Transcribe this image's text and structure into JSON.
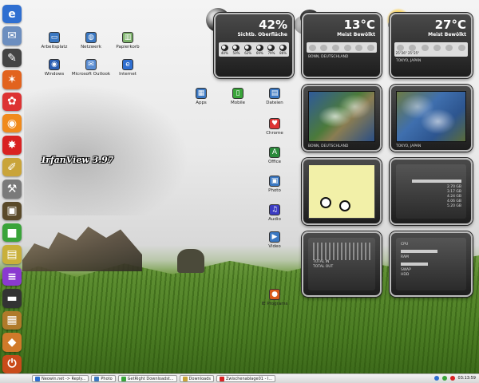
{
  "dock": {
    "items": [
      {
        "name": "internet-explorer-icon",
        "glyph": "e",
        "color": "#2f6fd1"
      },
      {
        "name": "mail-icon",
        "glyph": "✉",
        "color": "#6c8ebf"
      },
      {
        "name": "paintbrush-icon",
        "glyph": "✎",
        "color": "#444"
      },
      {
        "name": "firefox-icon",
        "glyph": "✶",
        "color": "#e2631e"
      },
      {
        "name": "flower-icon",
        "glyph": "✿",
        "color": "#d33"
      },
      {
        "name": "blender-icon",
        "glyph": "◉",
        "color": "#f08a1c"
      },
      {
        "name": "irfanview-icon",
        "glyph": "✸",
        "color": "#d92222"
      },
      {
        "name": "brushes-icon",
        "glyph": "✐",
        "color": "#c9a43a"
      },
      {
        "name": "tools-icon",
        "glyph": "⚒",
        "color": "#7a7a7a"
      },
      {
        "name": "folder-icon",
        "glyph": "▣",
        "color": "#5a4a2a"
      },
      {
        "name": "green-app-icon",
        "glyph": "■",
        "color": "#3aa43a"
      },
      {
        "name": "books-icon",
        "glyph": "▤",
        "color": "#c9b03a"
      },
      {
        "name": "stack-icon",
        "glyph": "≡",
        "color": "#8a3ad0"
      },
      {
        "name": "key-icon",
        "glyph": "▬",
        "color": "#333"
      },
      {
        "name": "package-icon",
        "glyph": "▦",
        "color": "#b07a2a"
      },
      {
        "name": "car-icon",
        "glyph": "◆",
        "color": "#d07a2a"
      },
      {
        "name": "power-icon",
        "glyph": "⏻",
        "color": "#c94b1a"
      }
    ],
    "hover_label": "IrfanView 3.97"
  },
  "desktop_icons": [
    {
      "name": "arbeitsplatz-icon",
      "label": "Arbeitsplatz",
      "color": "#3b78c2",
      "glyph": "▭"
    },
    {
      "name": "netzwerk-icon",
      "label": "Netzwerk",
      "color": "#3b78c2",
      "glyph": "◍"
    },
    {
      "name": "papierkorb-icon",
      "label": "Papierkorb",
      "color": "#7db36b",
      "glyph": "▥"
    },
    {
      "name": "windows-icon",
      "label": "Windows",
      "color": "#2b5fb3",
      "glyph": "◉"
    },
    {
      "name": "microsoft-outlook-icon",
      "label": "Microsoft Outlook",
      "color": "#5b8ed3",
      "glyph": "✉"
    },
    {
      "name": "internet-icon",
      "label": "Internet",
      "color": "#2f6fd1",
      "glyph": "e"
    },
    {
      "name": "apps-icon",
      "label": "Apps",
      "color": "#3b78c2",
      "glyph": "▦"
    },
    {
      "name": "mobile-icon",
      "label": "Mobile",
      "color": "#3aa43a",
      "glyph": "▯"
    },
    {
      "name": "dateien-icon",
      "label": "Dateien",
      "color": "#3b78c2",
      "glyph": "▤"
    },
    {
      "name": "chrome-icon",
      "label": "Chrome",
      "color": "#d33",
      "glyph": "♥"
    },
    {
      "name": "office-icon",
      "label": "Office",
      "color": "#2a8a3a",
      "glyph": "A"
    },
    {
      "name": "photo-icon",
      "label": "Photo",
      "color": "#3b78c2",
      "glyph": "▣"
    },
    {
      "name": "audio-icon",
      "label": "Audio",
      "color": "#3b3bc2",
      "glyph": "♫"
    },
    {
      "name": "video-icon",
      "label": "Video",
      "color": "#3b78c2",
      "glyph": "▶"
    },
    {
      "name": "ie-programs-icon",
      "label": "IE Programs",
      "color": "#d85a1a",
      "glyph": "●"
    }
  ],
  "weather": [
    {
      "name": "moon-widget",
      "value": "42%",
      "condition": "Sichtb. Oberfläche",
      "location": "",
      "details": [
        "",
        "",
        ""
      ],
      "row_labels": [
        "",
        "",
        "",
        "",
        "",
        ""
      ],
      "row_values": [
        "40%",
        "50%",
        "62%",
        "69%",
        "79%",
        "86%"
      ]
    },
    {
      "name": "weather-bonn-widget",
      "value": "13°C",
      "condition": "Meist Bewölkt",
      "location": "BONN, DEUTSCHLAND",
      "details": [
        "",
        "",
        ""
      ],
      "row_labels": [
        "",
        "",
        "",
        "",
        "",
        ""
      ],
      "row_values": [
        "",
        "",
        "",
        "",
        "",
        ""
      ]
    },
    {
      "name": "weather-tokyo-widget",
      "value": "27°C",
      "condition": "Meist Bewölkt",
      "location": "TOKYO, JAPAN",
      "details": [
        "",
        "",
        ""
      ],
      "row_labels": [
        "",
        "",
        "",
        "",
        "",
        ""
      ],
      "row_values": [
        "25°26°",
        "25°25°",
        "",
        "",
        "",
        ""
      ]
    }
  ],
  "satellite": [
    {
      "name": "satellite-europe",
      "label": "BONN, DEUTSCHLAND"
    },
    {
      "name": "satellite-japan",
      "label": "TOKYO, JAPAN"
    }
  ],
  "system": {
    "drives": [
      "2.70 GB",
      "3.17 GB",
      "4.24 GB",
      "4.06 GB",
      "5.20 GB"
    ],
    "net_lines": [
      "TOTAL IN",
      "TOTAL OUT"
    ],
    "net_values": [
      "",
      ""
    ],
    "cpu_lines": [
      "CPU",
      "RAM",
      "SWAP",
      "HDD"
    ],
    "cpu_values": [
      "",
      "",
      "",
      ""
    ]
  },
  "taskbar": {
    "tasks": [
      {
        "label": "Neowin.net -> Reply...",
        "color": "#2f6fd1"
      },
      {
        "label": "Photo",
        "color": "#3b78c2"
      },
      {
        "label": "GetRight Downloadst...",
        "color": "#3aa43a"
      },
      {
        "label": "Downloads",
        "color": "#c9a43a"
      },
      {
        "label": "Zwischenablage01 - I...",
        "color": "#d92222"
      }
    ],
    "clock": "03:13:59"
  },
  "colors": {
    "widget_border": "#bbbbbb",
    "grass": "#4b7c23"
  }
}
